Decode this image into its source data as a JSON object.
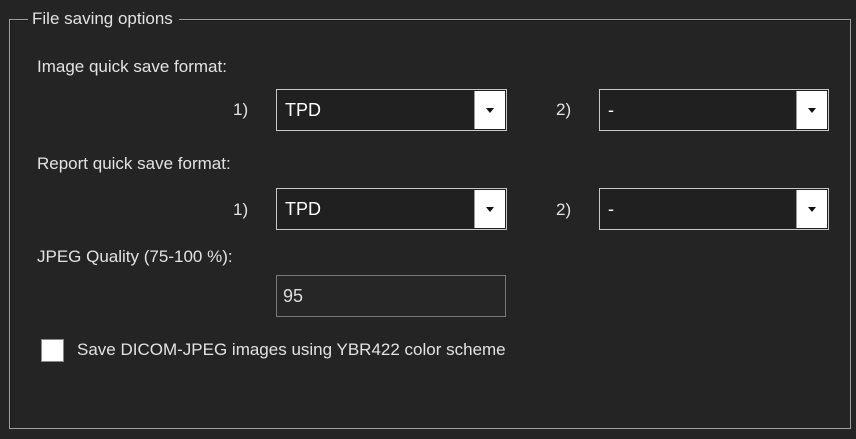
{
  "group": {
    "title": "File saving options"
  },
  "image_quick_save": {
    "label": "Image quick save format:",
    "slot1_label": "1)",
    "slot1_value": "TPD",
    "slot2_label": "2)",
    "slot2_value": "-"
  },
  "report_quick_save": {
    "label": "Report quick save format:",
    "slot1_label": "1)",
    "slot1_value": "TPD",
    "slot2_label": "2)",
    "slot2_value": "-"
  },
  "jpeg_quality": {
    "label": "JPEG Quality (75-100 %):",
    "value": "95"
  },
  "ybr_checkbox": {
    "label": "Save DICOM-JPEG images using YBR422 color scheme",
    "checked": false
  }
}
